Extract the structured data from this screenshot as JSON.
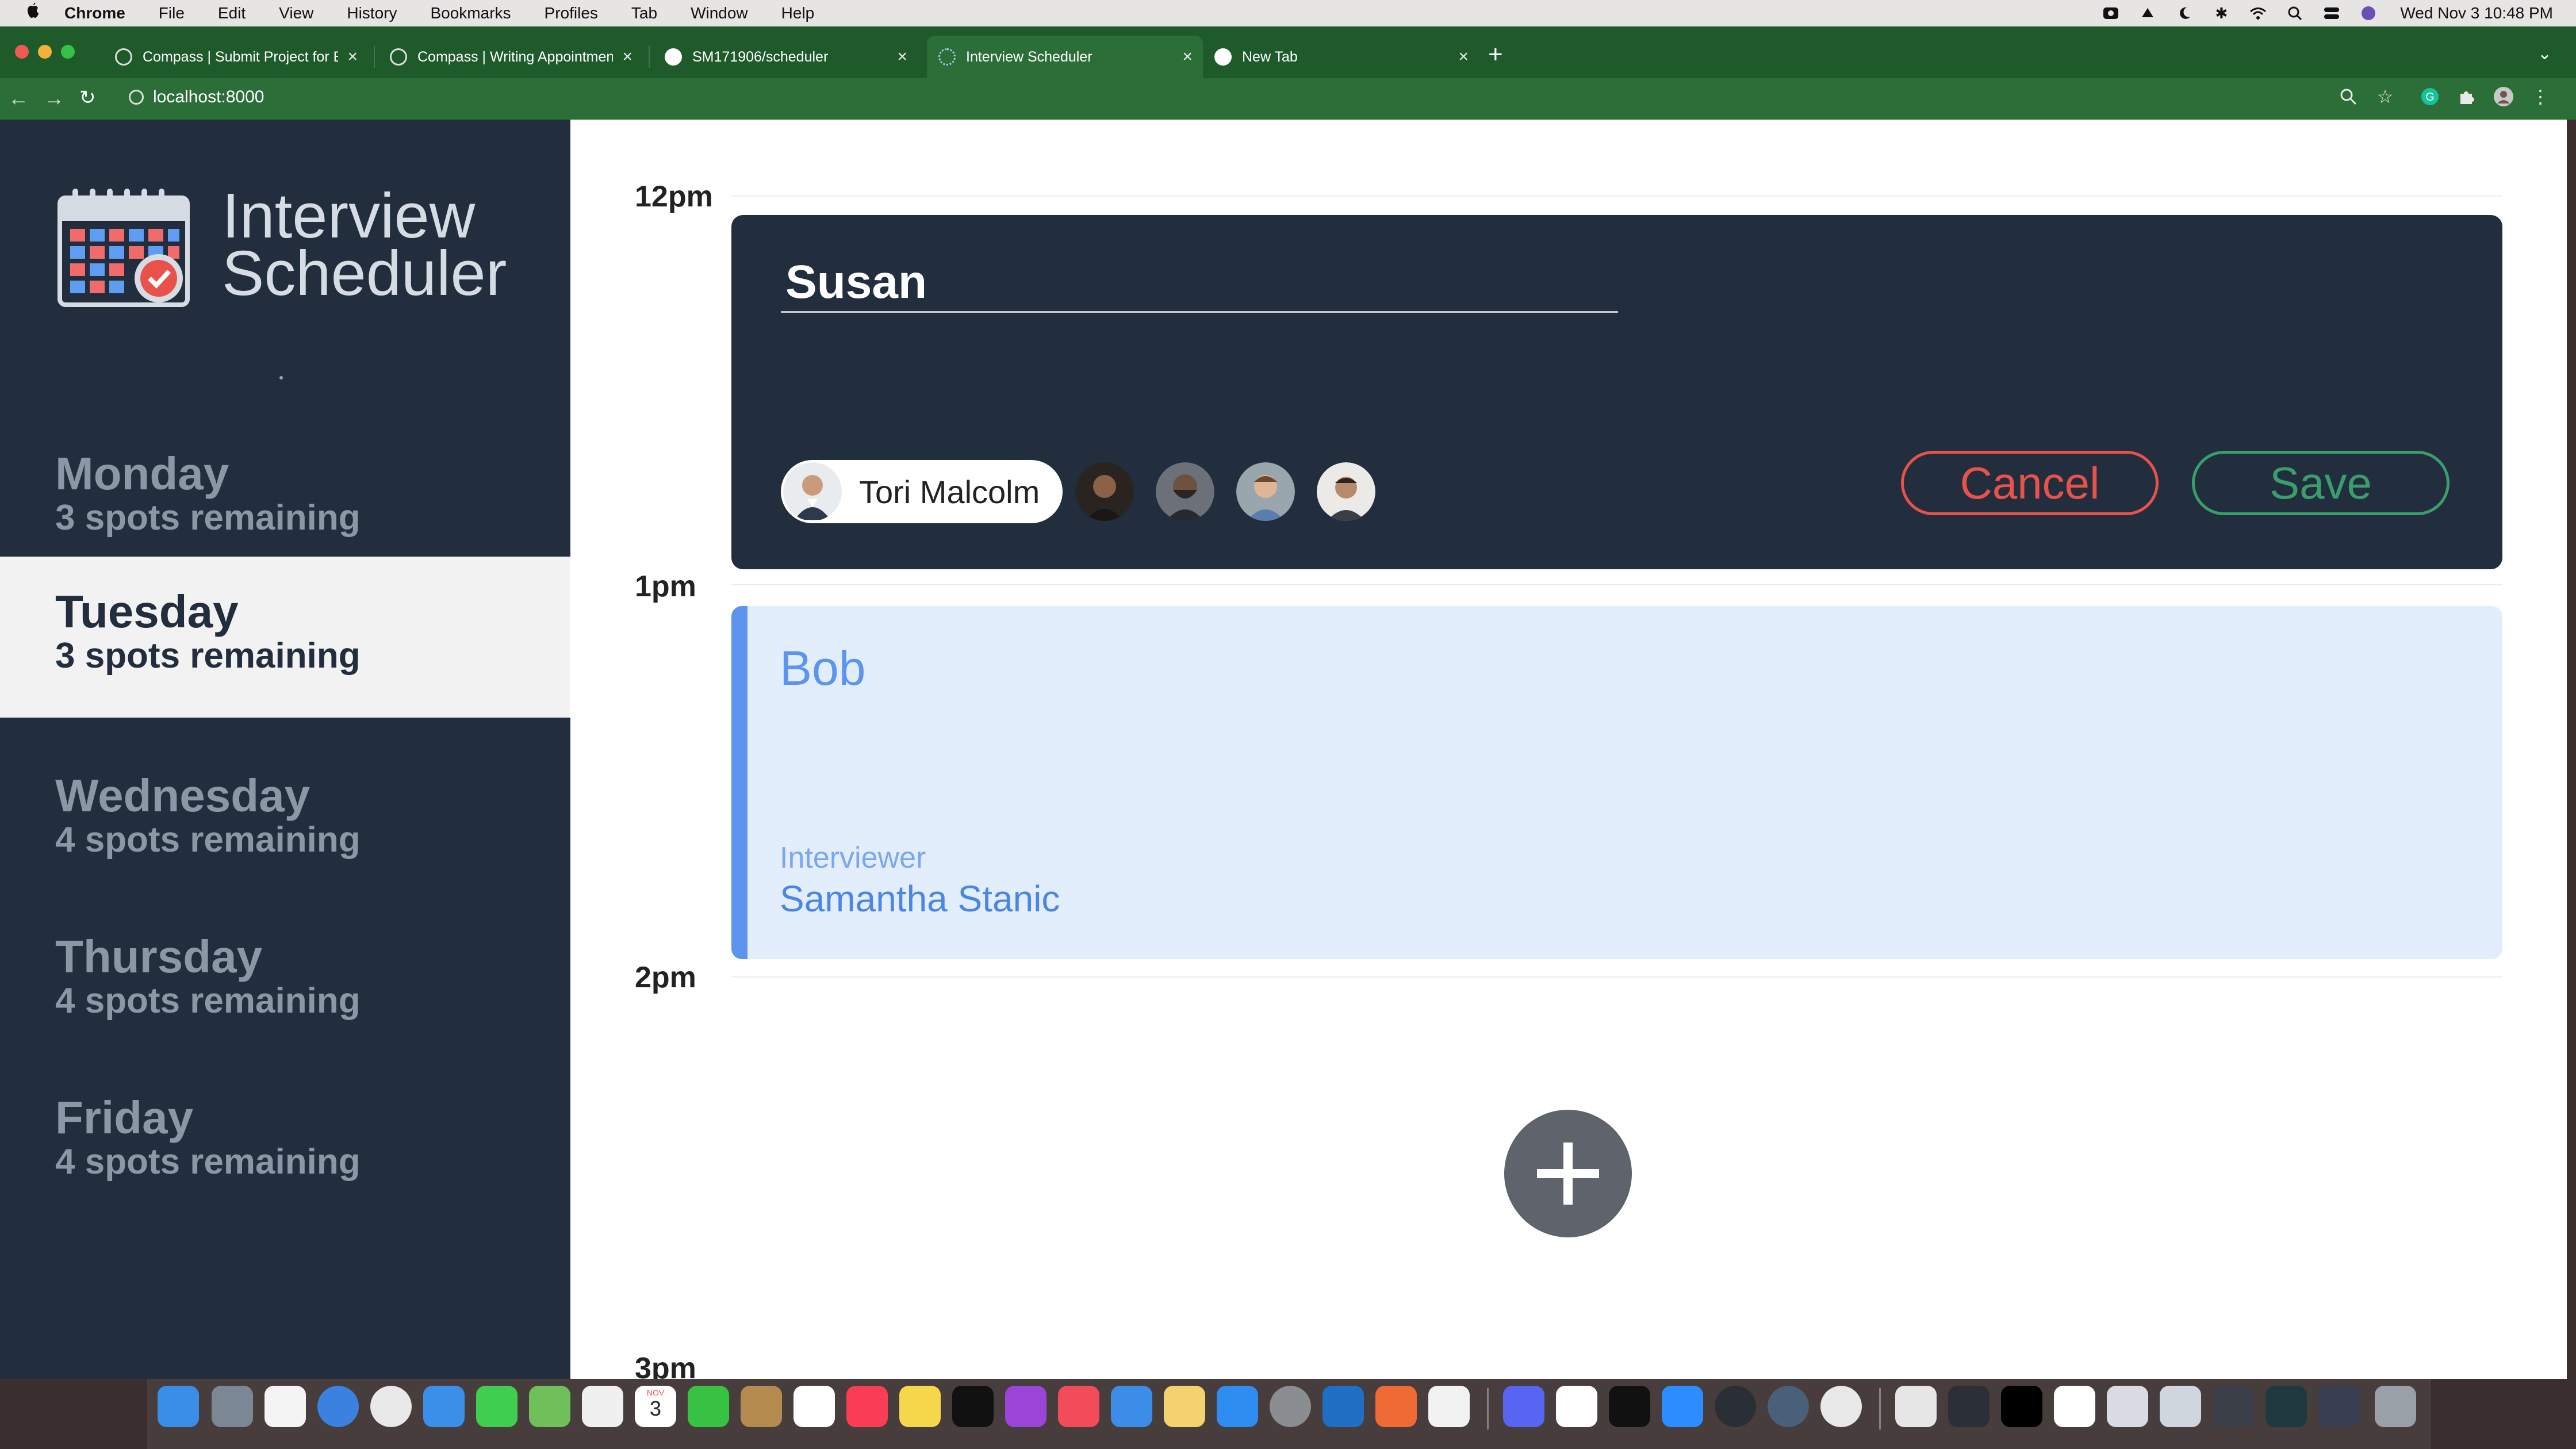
{
  "menubar": {
    "app": "Chrome",
    "items": [
      "File",
      "Edit",
      "View",
      "History",
      "Bookmarks",
      "Profiles",
      "Tab",
      "Window",
      "Help"
    ],
    "clock": "Wed Nov 3  10:48 PM"
  },
  "browser": {
    "tabs": [
      {
        "title": "Compass | Submit Project for E"
      },
      {
        "title": "Compass | Writing Appointmen"
      },
      {
        "title": "SM171906/scheduler"
      },
      {
        "title": "Interview Scheduler"
      },
      {
        "title": "New Tab"
      }
    ],
    "url": "localhost:8000"
  },
  "sidebar": {
    "logo_line1": "Interview",
    "logo_line2": "Scheduler",
    "days": [
      {
        "name": "Monday",
        "spots": "3 spots remaining",
        "selected": false
      },
      {
        "name": "Tuesday",
        "spots": "3 spots remaining",
        "selected": true
      },
      {
        "name": "Wednesday",
        "spots": "4 spots remaining",
        "selected": false
      },
      {
        "name": "Thursday",
        "spots": "4 spots remaining",
        "selected": false
      },
      {
        "name": "Friday",
        "spots": "4 spots remaining",
        "selected": false
      }
    ]
  },
  "schedule": {
    "hours": [
      "12pm",
      "1pm",
      "2pm",
      "3pm"
    ],
    "form": {
      "student_value": "Susan",
      "selected_interviewer": "Tori Malcolm",
      "cancel_label": "Cancel",
      "save_label": "Save"
    },
    "appointment": {
      "student": "Bob",
      "interviewer_label": "Interviewer",
      "interviewer": "Samantha Stanic"
    }
  },
  "dock": {
    "calendar_month": "NOV",
    "calendar_day": "3"
  },
  "colors": {
    "sidebar_bg": "#222d3d",
    "accent_blue": "#5d95ee",
    "cancel_red": "#e8524a",
    "save_green": "#3a9e6c"
  }
}
